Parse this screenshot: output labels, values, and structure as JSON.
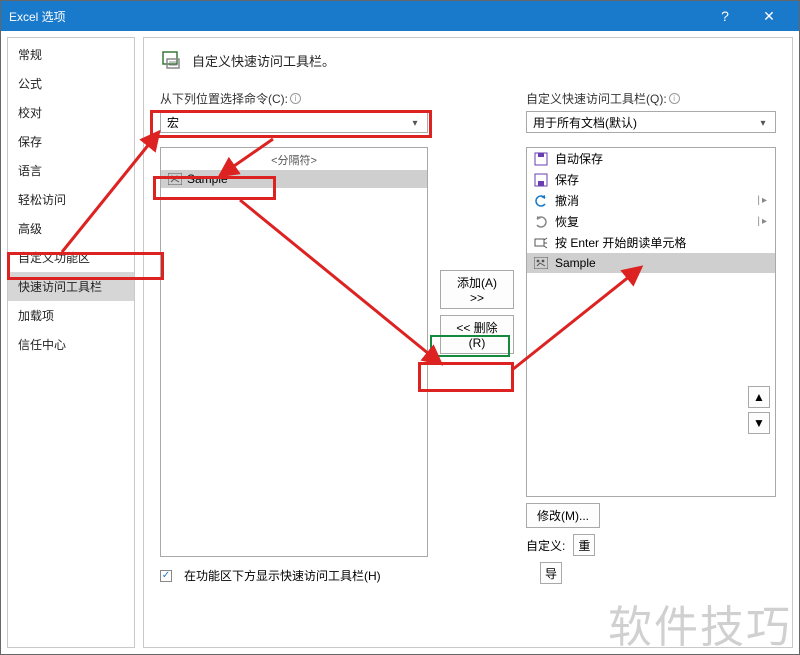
{
  "titlebar": {
    "title": "Excel 选项",
    "help": "?",
    "close": "✕"
  },
  "sidebar": {
    "items": [
      {
        "label": "常规"
      },
      {
        "label": "公式"
      },
      {
        "label": "校对"
      },
      {
        "label": "保存"
      },
      {
        "label": "语言"
      },
      {
        "label": "轻松访问"
      },
      {
        "label": "高级"
      },
      {
        "label": "自定义功能区"
      },
      {
        "label": "快速访问工具栏",
        "selected": true
      },
      {
        "label": "加载项"
      },
      {
        "label": "信任中心"
      }
    ]
  },
  "header": {
    "text": "自定义快速访问工具栏。"
  },
  "left": {
    "label": "从下列位置选择命令(C):",
    "dropdown": "宏",
    "separator_text": "<分隔符>",
    "sample": "Sample"
  },
  "middle": {
    "add": "添加(A) >>",
    "remove": "<< 删除(R)"
  },
  "right": {
    "label": "自定义快速访问工具栏(Q):",
    "dropdown": "用于所有文档(默认)",
    "items": [
      {
        "icon": "autosave-icon",
        "label": "自动保存"
      },
      {
        "icon": "save-icon",
        "label": "保存"
      },
      {
        "icon": "undo-icon",
        "label": "撤消",
        "sep": true
      },
      {
        "icon": "redo-icon",
        "label": "恢复",
        "sep": true
      },
      {
        "icon": "speak-icon",
        "label": "按 Enter 开始朗读单元格"
      },
      {
        "icon": "macro-icon",
        "label": "Sample",
        "selected": true
      }
    ],
    "modify": "修改(M)...",
    "custom_label": "自定义:",
    "reset_icon": "重",
    "import_icon": "导"
  },
  "reorder": {
    "up": "▲",
    "down": "▼"
  },
  "footer": {
    "checkbox_label": "在功能区下方显示快速访问工具栏(H)"
  },
  "watermark": "软件技巧"
}
